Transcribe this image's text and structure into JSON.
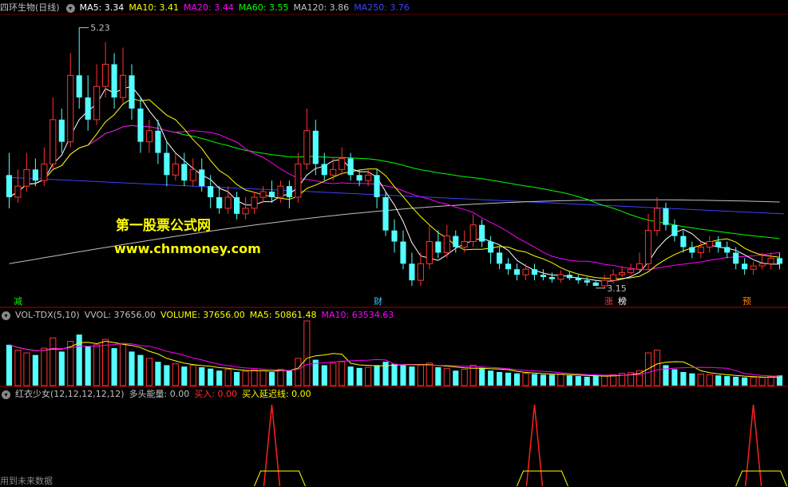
{
  "main_legend": {
    "title": "四环生物(日线)",
    "items": [
      {
        "label": "MA5: 3.34",
        "color": "#ffffff"
      },
      {
        "label": "MA10: 3.41",
        "color": "#ffff00"
      },
      {
        "label": "MA20: 3.44",
        "color": "#ff00ff"
      },
      {
        "label": "MA60: 3.55",
        "color": "#00ff00"
      },
      {
        "label": "MA120: 3.86",
        "color": "#c0c0c0"
      },
      {
        "label": "MA250: 3.76",
        "color": "#4040ff"
      }
    ]
  },
  "vol_legend": {
    "title": "VOL-TDX(5,10)",
    "items": [
      {
        "label": "VVOL: 37656.00",
        "color": "#c0c0c0"
      },
      {
        "label": "VOLUME: 37656.00",
        "color": "#ffff00"
      },
      {
        "label": "MA5: 50861.48",
        "color": "#ffff00"
      },
      {
        "label": "MA10: 63534.63",
        "color": "#ff00ff"
      }
    ]
  },
  "ind_legend": {
    "title": "红衣少女(12,12,12,12,12)",
    "items": [
      {
        "label": "多头能量: 0.00",
        "color": "#c0c0c0"
      },
      {
        "label": "买入: 0.00",
        "color": "#ff3333"
      },
      {
        "label": "买入延迟线: 0.00",
        "color": "#ffff00"
      }
    ]
  },
  "watermark": {
    "line1": "第一股票公式网",
    "line2": "www.chnmoney.com"
  },
  "event_tags": [
    {
      "text": "减",
      "color": "#00ff00"
    },
    {
      "text": "财",
      "color": "#33ccff"
    },
    {
      "text": "涨",
      "color": "#ff4040"
    },
    {
      "text": "榜",
      "color": "#ffffff"
    },
    {
      "text": "预",
      "color": "#ff8800"
    }
  ],
  "footer": "用到未来数据",
  "chart_data": {
    "type": "candlestick",
    "price_labels": {
      "high": "5.23",
      "low": "3.15"
    },
    "up_color": "#ff3232",
    "down_color": "#54ffff",
    "candles": [
      [
        3.9,
        3.7,
        4.1,
        3.6
      ],
      [
        3.7,
        3.8,
        3.95,
        3.65
      ],
      [
        3.8,
        3.95,
        4.1,
        3.75
      ],
      [
        3.95,
        3.85,
        4.05,
        3.8
      ],
      [
        3.85,
        4.0,
        4.15,
        3.8
      ],
      [
        4.0,
        4.4,
        4.6,
        3.95
      ],
      [
        4.4,
        4.2,
        4.5,
        4.1
      ],
      [
        4.2,
        4.8,
        5.0,
        4.15
      ],
      [
        4.8,
        4.6,
        5.23,
        4.5
      ],
      [
        4.6,
        4.4,
        4.8,
        4.3
      ],
      [
        4.4,
        4.7,
        4.9,
        4.35
      ],
      [
        4.7,
        4.9,
        5.1,
        4.6
      ],
      [
        4.9,
        4.6,
        5.0,
        4.5
      ],
      [
        4.6,
        4.8,
        5.05,
        4.55
      ],
      [
        4.8,
        4.5,
        4.9,
        4.4
      ],
      [
        4.5,
        4.2,
        4.6,
        4.1
      ],
      [
        4.2,
        4.3,
        4.4,
        4.1
      ],
      [
        4.3,
        4.1,
        4.4,
        4.0
      ],
      [
        4.1,
        3.9,
        4.2,
        3.8
      ],
      [
        3.9,
        4.0,
        4.1,
        3.85
      ],
      [
        4.0,
        3.85,
        4.1,
        3.8
      ],
      [
        3.85,
        3.95,
        4.05,
        3.8
      ],
      [
        3.95,
        3.8,
        4.05,
        3.75
      ],
      [
        3.8,
        3.7,
        3.9,
        3.6
      ],
      [
        3.7,
        3.6,
        3.8,
        3.55
      ],
      [
        3.6,
        3.7,
        3.8,
        3.55
      ],
      [
        3.7,
        3.55,
        3.75,
        3.5
      ],
      [
        3.55,
        3.6,
        3.7,
        3.5
      ],
      [
        3.6,
        3.7,
        3.75,
        3.55
      ],
      [
        3.7,
        3.75,
        3.8,
        3.65
      ],
      [
        3.75,
        3.7,
        3.85,
        3.65
      ],
      [
        3.7,
        3.8,
        3.85,
        3.65
      ],
      [
        3.8,
        3.7,
        3.85,
        3.6
      ],
      [
        3.7,
        4.0,
        4.1,
        3.65
      ],
      [
        4.0,
        4.3,
        4.5,
        3.95
      ],
      [
        4.3,
        4.0,
        4.4,
        3.9
      ],
      [
        4.0,
        3.9,
        4.1,
        3.85
      ],
      [
        3.9,
        3.95,
        4.05,
        3.85
      ],
      [
        3.95,
        4.05,
        4.15,
        3.9
      ],
      [
        4.05,
        3.9,
        4.1,
        3.85
      ],
      [
        3.9,
        3.85,
        3.95,
        3.8
      ],
      [
        3.85,
        3.9,
        3.95,
        3.8
      ],
      [
        3.9,
        3.7,
        3.95,
        3.6
      ],
      [
        3.7,
        3.4,
        3.75,
        3.35
      ],
      [
        3.4,
        3.3,
        3.5,
        3.2
      ],
      [
        3.3,
        3.1,
        3.4,
        3.05
      ],
      [
        3.1,
        2.95,
        3.2,
        2.9
      ],
      [
        2.95,
        3.1,
        3.2,
        2.9
      ],
      [
        3.1,
        3.3,
        3.45,
        3.05
      ],
      [
        3.3,
        3.2,
        3.4,
        3.15
      ],
      [
        3.2,
        3.35,
        3.45,
        3.15
      ],
      [
        3.35,
        3.25,
        3.4,
        3.2
      ],
      [
        3.25,
        3.3,
        3.4,
        3.2
      ],
      [
        3.3,
        3.45,
        3.55,
        3.25
      ],
      [
        3.45,
        3.3,
        3.5,
        3.25
      ],
      [
        3.3,
        3.2,
        3.35,
        3.1
      ],
      [
        3.2,
        3.1,
        3.25,
        3.05
      ],
      [
        3.1,
        3.05,
        3.15,
        3.0
      ],
      [
        3.05,
        3.0,
        3.1,
        2.95
      ],
      [
        3.0,
        3.05,
        3.1,
        2.95
      ],
      [
        3.05,
        3.0,
        3.1,
        2.95
      ],
      [
        3.0,
        2.98,
        3.05,
        2.95
      ],
      [
        2.98,
        2.96,
        3.02,
        2.93
      ],
      [
        2.96,
        3.0,
        3.04,
        2.93
      ],
      [
        3.0,
        2.97,
        3.03,
        2.95
      ],
      [
        2.97,
        2.95,
        3.0,
        2.92
      ],
      [
        2.95,
        2.93,
        2.98,
        2.9
      ],
      [
        2.93,
        2.9,
        2.95,
        3.15
      ],
      [
        2.9,
        2.95,
        3.0,
        2.88
      ],
      [
        2.95,
        3.0,
        3.05,
        2.92
      ],
      [
        3.0,
        3.02,
        3.08,
        2.98
      ],
      [
        3.02,
        3.05,
        3.1,
        3.0
      ],
      [
        3.05,
        3.1,
        3.2,
        3.03
      ],
      [
        3.1,
        3.4,
        3.55,
        3.05
      ],
      [
        3.4,
        3.6,
        3.7,
        3.35
      ],
      [
        3.6,
        3.45,
        3.65,
        3.4
      ],
      [
        3.45,
        3.35,
        3.5,
        3.3
      ],
      [
        3.35,
        3.25,
        3.4,
        3.2
      ],
      [
        3.25,
        3.2,
        3.3,
        3.15
      ],
      [
        3.2,
        3.25,
        3.3,
        3.15
      ],
      [
        3.25,
        3.3,
        3.35,
        3.2
      ],
      [
        3.3,
        3.25,
        3.35,
        3.2
      ],
      [
        3.25,
        3.2,
        3.3,
        3.15
      ],
      [
        3.2,
        3.1,
        3.25,
        3.05
      ],
      [
        3.1,
        3.05,
        3.15,
        3.0
      ],
      [
        3.05,
        3.08,
        3.12,
        3.0
      ],
      [
        3.08,
        3.1,
        3.2,
        3.05
      ],
      [
        3.1,
        3.15,
        3.2,
        3.05
      ],
      [
        3.15,
        3.1,
        3.2,
        3.05
      ]
    ],
    "ma": [
      {
        "name": "MA5",
        "color": "#ffffff"
      },
      {
        "name": "MA10",
        "color": "#ffff00"
      },
      {
        "name": "MA20",
        "color": "#ff00ff"
      },
      {
        "name": "MA60",
        "color": "#00ff00"
      },
      {
        "name": "MA120",
        "color": "#c0c0c0"
      },
      {
        "name": "MA250",
        "color": "#4040ff"
      }
    ],
    "ma250_endpoints": [
      3.88,
      3.55
    ],
    "ma120_endpoints": [
      3.1,
      3.58
    ],
    "volume": [
      60,
      52,
      48,
      45,
      55,
      70,
      50,
      65,
      75,
      58,
      60,
      68,
      55,
      62,
      50,
      45,
      40,
      35,
      30,
      32,
      28,
      30,
      27,
      25,
      22,
      24,
      20,
      21,
      23,
      22,
      20,
      24,
      22,
      40,
      95,
      38,
      30,
      33,
      35,
      28,
      26,
      27,
      30,
      35,
      32,
      30,
      28,
      30,
      33,
      27,
      25,
      22,
      24,
      30,
      26,
      22,
      20,
      19,
      18,
      18,
      17,
      16,
      16,
      17,
      15,
      14,
      13,
      14,
      14,
      16,
      18,
      19,
      22,
      48,
      52,
      30,
      24,
      20,
      18,
      17,
      16,
      15,
      14,
      13,
      12,
      12,
      12,
      13,
      15
    ],
    "signal_peaks": [
      30,
      60,
      85
    ]
  }
}
